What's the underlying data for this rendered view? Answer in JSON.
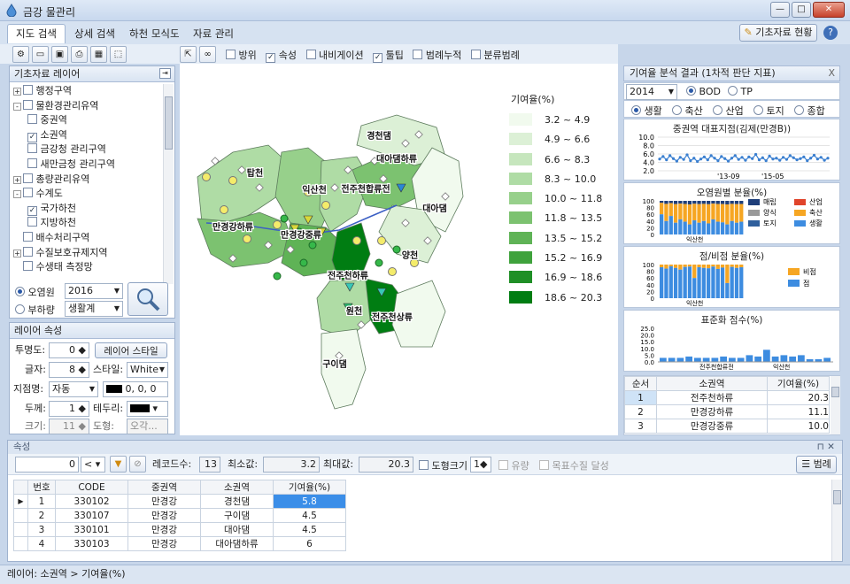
{
  "app": {
    "title": "금강 물관리"
  },
  "menu_tabs": [
    "지도 검색",
    "상세 검색",
    "하천 모식도",
    "자료 관리"
  ],
  "top_right": {
    "base_data_button": "기초자료 현황",
    "help_icon": "help-icon"
  },
  "toolbar": {
    "checks": [
      {
        "label": "방위",
        "checked": false
      },
      {
        "label": "속성",
        "checked": true
      },
      {
        "label": "내비게이션",
        "checked": false
      },
      {
        "label": "툴팁",
        "checked": true
      },
      {
        "label": "범례누적",
        "checked": false
      },
      {
        "label": "분류범례",
        "checked": false
      }
    ]
  },
  "layer_panel": {
    "title": "기초자료 레이어",
    "items": [
      {
        "label": "행정구역",
        "level": 0,
        "expand": "+",
        "checked": false
      },
      {
        "label": "물환경관리유역",
        "level": 0,
        "expand": "-",
        "checked": false
      },
      {
        "label": "중권역",
        "level": 1,
        "expand": "",
        "checked": false
      },
      {
        "label": "소권역",
        "level": 1,
        "expand": "",
        "checked": true
      },
      {
        "label": "금강청 관리구역",
        "level": 1,
        "expand": "",
        "checked": false
      },
      {
        "label": "새만금청 관리구역",
        "level": 1,
        "expand": "",
        "checked": false
      },
      {
        "label": "총량관리유역",
        "level": 0,
        "expand": "+",
        "checked": false
      },
      {
        "label": "수계도",
        "level": 0,
        "expand": "-",
        "checked": false
      },
      {
        "label": "국가하천",
        "level": 1,
        "expand": "",
        "checked": true
      },
      {
        "label": "지방하천",
        "level": 1,
        "expand": "",
        "checked": false
      },
      {
        "label": "배수처리구역",
        "level": 0,
        "expand": "",
        "checked": false
      },
      {
        "label": "수질보호규제지역",
        "level": 0,
        "expand": "+",
        "checked": false
      },
      {
        "label": "수생태 측정망",
        "level": 0,
        "expand": "",
        "checked": false
      }
    ],
    "pollution_source": {
      "label": "오염원",
      "selected": true,
      "year": "2016"
    },
    "load": {
      "label": "부하량",
      "selected": false,
      "value": "생활계"
    }
  },
  "layer_props": {
    "title": "레이어 속성",
    "transparency_label": "투명도:",
    "transparency": "0",
    "style_button": "레이어 스타일",
    "font_label": "글자:",
    "font_size": "8",
    "style_label": "스타일:",
    "style_value": "White",
    "point_name_label": "지점명:",
    "point_name_value": "자동",
    "color_value": "0, 0, 0",
    "thickness_label": "두께:",
    "thickness": "1",
    "border_label": "테두리:",
    "size_label": "크기:",
    "size": "11",
    "shape_label": "도형:",
    "shape_value": "오각..."
  },
  "map": {
    "legend_title": "기여율(%)",
    "legend": [
      {
        "range": "3.2 ~ 4.9",
        "color": "#f1faee"
      },
      {
        "range": "4.9 ~ 6.6",
        "color": "#dcf0d6"
      },
      {
        "range": "6.6 ~ 8.3",
        "color": "#c6e6bd"
      },
      {
        "range": "8.3 ~ 10.0",
        "color": "#afdca5"
      },
      {
        "range": "10.0 ~ 11.8",
        "color": "#97d08b"
      },
      {
        "range": "11.8 ~ 13.5",
        "color": "#7cc270"
      },
      {
        "range": "13.5 ~ 15.2",
        "color": "#5fb356"
      },
      {
        "range": "15.2 ~ 16.9",
        "color": "#3fa23c"
      },
      {
        "range": "16.9 ~ 18.6",
        "color": "#1f8f26"
      },
      {
        "range": "18.6 ~ 20.3",
        "color": "#007d12"
      }
    ],
    "region_labels": [
      "경천댐",
      "대아댐하류",
      "대아댐",
      "탑천",
      "익산천",
      "전주천합류전",
      "만경강하류",
      "만경강중류",
      "양천",
      "전주천하류",
      "전주천상류",
      "원천",
      "구이댐"
    ]
  },
  "analysis": {
    "title": "기여율 분석 결과 (1차적 판단 지표)",
    "year": "2014",
    "indicators": [
      {
        "label": "BOD",
        "selected": true
      },
      {
        "label": "TP",
        "selected": false
      }
    ],
    "sources": [
      {
        "label": "생활",
        "selected": true
      },
      {
        "label": "축산",
        "selected": false
      },
      {
        "label": "산업",
        "selected": false
      },
      {
        "label": "토지",
        "selected": false
      },
      {
        "label": "종합",
        "selected": false
      }
    ],
    "rep_chart": {
      "title": "중권역 대표지점(김제(만경B))",
      "ticks": [
        "10.0",
        "8.0",
        "6.0",
        "4.0",
        "2.0"
      ],
      "xticks": [
        "'13-09",
        "'15-05"
      ]
    },
    "by_source": {
      "title": "오염원별 분율(%)",
      "ticks": [
        "100",
        "80",
        "60",
        "40",
        "20",
        "0"
      ],
      "xlabel": "익산천",
      "legend": [
        "매립",
        "산업",
        "양식",
        "축산",
        "토지",
        "생활"
      ],
      "legend_colors": [
        "#1f3f7a",
        "#e0442b",
        "#9a9a9a",
        "#f6a623",
        "#2f5f9c",
        "#3d8ce0"
      ]
    },
    "point_nonpoint": {
      "title": "점/비점 분율(%)",
      "ticks": [
        "100",
        "80",
        "60",
        "40",
        "20",
        "0"
      ],
      "xlabel": "익산천",
      "legend": [
        "비점",
        "점"
      ],
      "legend_colors": [
        "#f6a623",
        "#3d8ce0"
      ]
    },
    "standard": {
      "title": "표준화 점수(%)",
      "ticks": [
        "25.0",
        "20.0",
        "15.0",
        "10.0",
        "5.0",
        "0.0"
      ],
      "xlabels": [
        "전주천합류전",
        "익산천"
      ],
      "values": [
        3,
        3,
        3,
        4,
        3,
        3,
        3,
        4,
        3,
        3,
        5,
        4,
        9,
        4,
        5,
        4,
        5,
        2,
        2,
        3
      ]
    },
    "rank": {
      "headers": [
        "순서",
        "소권역",
        "기여율(%)"
      ],
      "rows": [
        [
          "1",
          "전주천하류",
          "20.3"
        ],
        [
          "2",
          "만경강하류",
          "11.1"
        ],
        [
          "3",
          "만경강중류",
          "10.0"
        ]
      ]
    }
  },
  "attributes": {
    "title": "속성",
    "value": "0",
    "operator": "<",
    "record_label": "레코드수:",
    "record_count": "13",
    "min_label": "최소값:",
    "min": "3.2",
    "max_label": "최대값:",
    "max": "20.3",
    "shape_size_label": "도형크기",
    "shape_size": "1",
    "flow_label": "유량",
    "target_label": "목표수질 달성",
    "legend_button": "범례",
    "headers": [
      "번호",
      "CODE",
      "중권역",
      "소권역",
      "기여율(%)"
    ],
    "rows": [
      [
        "1",
        "330102",
        "만경강",
        "경천댐",
        "5.8"
      ],
      [
        "2",
        "330107",
        "만경강",
        "구이댐",
        "4.5"
      ],
      [
        "3",
        "330101",
        "만경강",
        "대아댐",
        "4.5"
      ],
      [
        "4",
        "330103",
        "만경강",
        "대아댐하류",
        "6"
      ]
    ]
  },
  "status": "레이어: 소권역 > 기여율(%)",
  "chart_data": [
    {
      "type": "line",
      "title": "중권역 대표지점(김제(만경B))",
      "ylim": [
        0,
        10
      ],
      "values": [
        4.8,
        5.4,
        4.6,
        5.6,
        4.9,
        4.3,
        5.2,
        4.7,
        5.8,
        4.4,
        5.0,
        4.2,
        4.8,
        5.3,
        4.6,
        5.6,
        5.0,
        4.4,
        5.4,
        4.9,
        4.3,
        5.0,
        5.6,
        4.7,
        5.2,
        4.5,
        5.3,
        4.9,
        5.9,
        4.6,
        5.1,
        4.4,
        5.5,
        4.8,
        5.0,
        4.5,
        5.2,
        4.7,
        5.6,
        5.1,
        4.6,
        4.9,
        5.3,
        4.4,
        5.0,
        5.7,
        4.8,
        5.2,
        4.5,
        5.0
      ]
    },
    {
      "type": "bar",
      "title": "표준화 점수(%)",
      "ylim": [
        0,
        25
      ],
      "values": [
        3,
        3,
        3,
        4,
        3,
        3,
        3,
        4,
        3,
        3,
        5,
        4,
        9,
        4,
        5,
        4,
        5,
        2,
        2,
        3
      ]
    }
  ]
}
